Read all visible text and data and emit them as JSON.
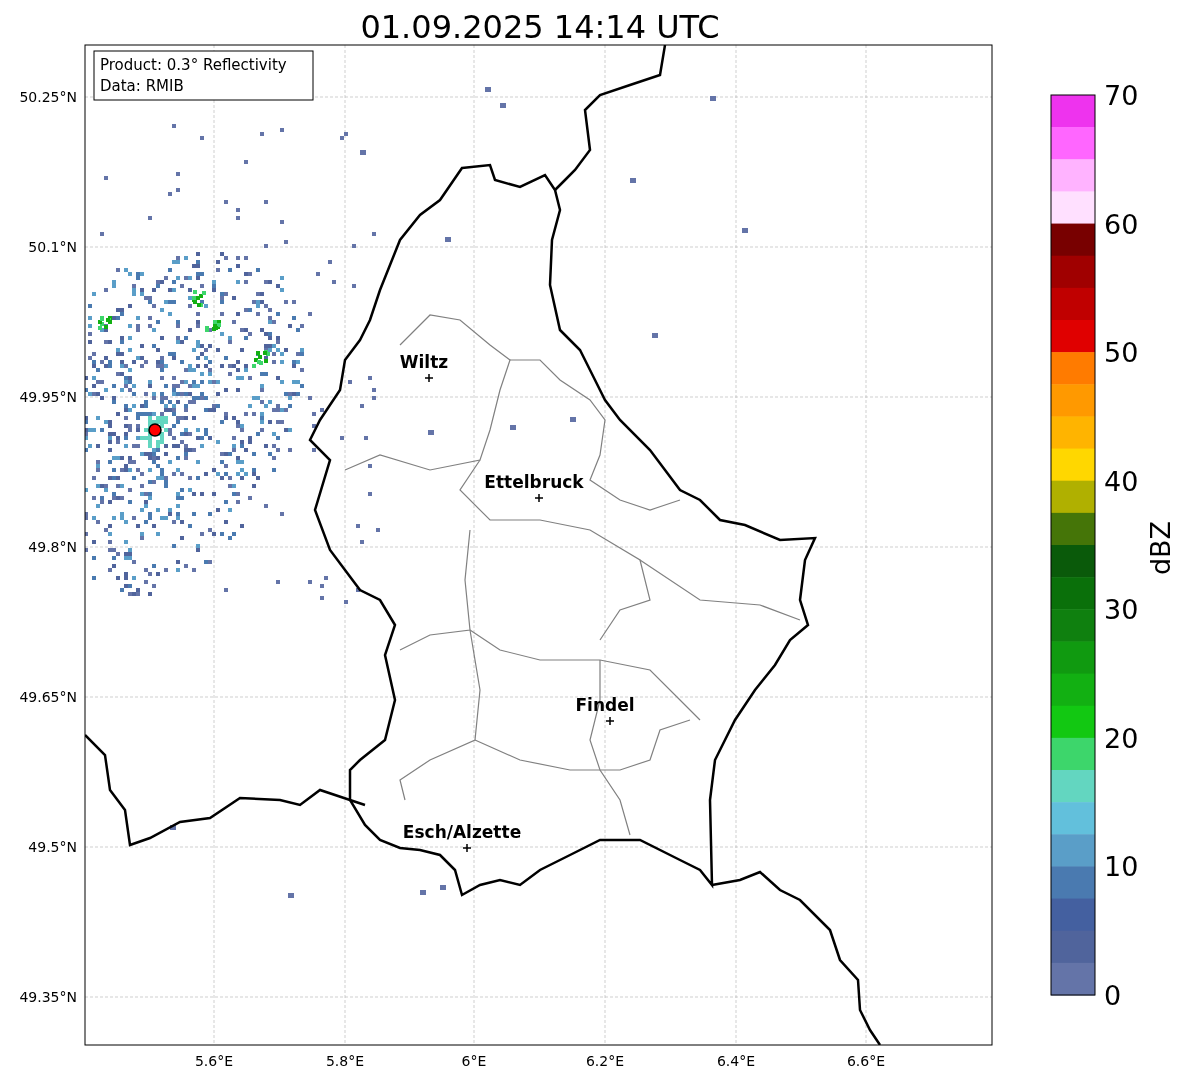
{
  "title": "01.09.2025 14:14 UTC",
  "info_box": {
    "lines": [
      "Product: 0.3° Reflectivity",
      "Data: RMIB"
    ]
  },
  "map": {
    "lat_ticks": [
      "50.25°N",
      "50.1°N",
      "49.95°N",
      "49.8°N",
      "49.65°N",
      "49.5°N",
      "49.35°N"
    ],
    "lon_ticks": [
      "5.6°E",
      "5.8°E",
      "6°E",
      "6.2°E",
      "6.4°E",
      "6.6°E"
    ],
    "places": [
      {
        "name": "Wiltz"
      },
      {
        "name": "Ettelbruck"
      },
      {
        "name": "Findel"
      },
      {
        "name": "Esch/Alzette"
      }
    ]
  },
  "colorbar": {
    "label": "dBZ",
    "ticks": [
      "70",
      "60",
      "50",
      "40",
      "30",
      "20",
      "10",
      "0"
    ],
    "bins": [
      {
        "color": "#ee33ee"
      },
      {
        "color": "#ff66ff"
      },
      {
        "color": "#ffb3ff"
      },
      {
        "color": "#ffe0ff"
      },
      {
        "color": "#780000"
      },
      {
        "color": "#a00000"
      },
      {
        "color": "#c00000"
      },
      {
        "color": "#e00000"
      },
      {
        "color": "#ff7b00"
      },
      {
        "color": "#ff9900"
      },
      {
        "color": "#ffb400"
      },
      {
        "color": "#ffd700"
      },
      {
        "color": "#b0b000"
      },
      {
        "color": "#457508"
      },
      {
        "color": "#0a5a0a"
      },
      {
        "color": "#0a700a"
      },
      {
        "color": "#0f800f"
      },
      {
        "color": "#109a10"
      },
      {
        "color": "#12b012"
      },
      {
        "color": "#12c812"
      },
      {
        "color": "#3dd66b"
      },
      {
        "color": "#63d6c0"
      },
      {
        "color": "#62c0dc"
      },
      {
        "color": "#5a9ec8"
      },
      {
        "color": "#4a7ab0"
      },
      {
        "color": "#4460a0"
      },
      {
        "color": "#50649c"
      },
      {
        "color": "#6474a8"
      }
    ]
  }
}
